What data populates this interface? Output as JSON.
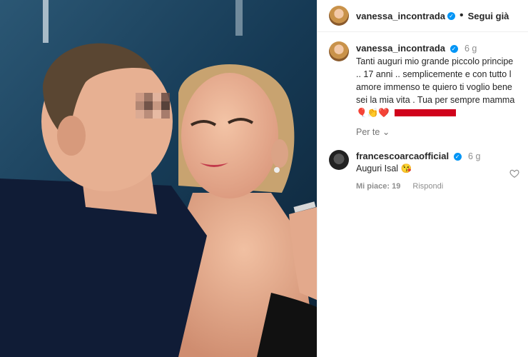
{
  "post": {
    "author": "vanessa_incontrada",
    "follow_label": "Segui già",
    "dot": "•"
  },
  "caption": {
    "author": "vanessa_incontrada",
    "time": "6 g",
    "text": "Tanti auguri mio grande piccolo principe .. 17 anni .. semplicemente e con tutto l amore immenso te quiero ti voglio bene sei la mia vita . Tua per sempre mamma",
    "emojis": "🎈👏❤️"
  },
  "translate_label": "Per te",
  "comments": [
    {
      "author": "francescoarcaofficial",
      "time": "6 g",
      "text": "Auguri Isal 😘",
      "likes_label": "Mi piace: 19",
      "reply_label": "Rispondi"
    }
  ],
  "icons": {
    "verified": "verified-badge-icon",
    "heart": "heart-outline-icon",
    "chevron": "chevron-down-icon"
  },
  "colors": {
    "verified": "#0095f6",
    "redaction": "#d0021b"
  }
}
